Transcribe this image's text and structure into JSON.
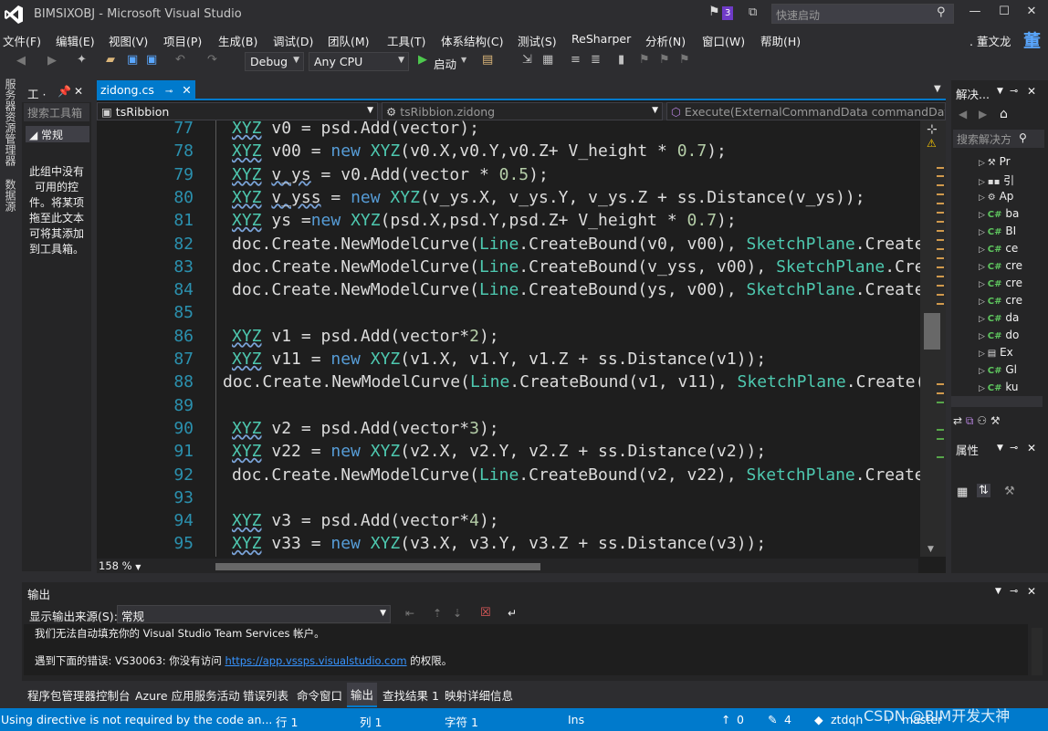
{
  "window": {
    "title": "BIMSIXOBJ - Microsoft Visual Studio",
    "notification_count": "3",
    "quick_launch_placeholder": "快速启动"
  },
  "menu": [
    "文件(F)",
    "编辑(E)",
    "视图(V)",
    "项目(P)",
    "生成(B)",
    "调试(D)",
    "团队(M)",
    "工具(T)",
    "体系结构(C)",
    "测试(S)",
    "ReSharper",
    "分析(N)",
    "窗口(W)",
    "帮助(H)"
  ],
  "user": {
    "name": ". 董文龙",
    "avatar": "董"
  },
  "toolbar": {
    "config": "Debug",
    "platform": "Any CPU",
    "start": "启动"
  },
  "left_strip": {
    "server_explorer": "服务器资源管理器",
    "data_sources": "数据源"
  },
  "toolbox": {
    "title": "工 ·",
    "search_placeholder": "搜索工具箱",
    "group": "◢ 常规",
    "empty_msg": "此组中没有可用的控件。将某项拖至此文本可将其添加到工具箱。"
  },
  "editor": {
    "tab": "zidong.cs",
    "nav_class": "tsRibbion",
    "nav_type": "tsRibbion.zidong",
    "nav_member": "Execute(ExternalCommandData commandData",
    "zoom": "158 %",
    "lines": [
      {
        "num": "77",
        "html": "<span class='t sq'>XYZ</span> v0 = psd.Add(vector);"
      },
      {
        "num": "78",
        "html": "<span class='t sq'>XYZ</span> v00 = <span class='k'>new</span> <span class='t'>XYZ</span>(v0.X,v0.Y,v0.Z+ V_height * <span class='n'>0.7</span>);"
      },
      {
        "num": "79",
        "html": "<span class='t sq'>XYZ</span> <span class='sq'>v_ys</span> = v0.Add(vector * <span class='n'>0.5</span>);"
      },
      {
        "num": "80",
        "html": "<span class='t sq'>XYZ</span> <span class='sq'>v_yss</span> = <span class='k'>new</span> <span class='t'>XYZ</span>(v_ys.X, v_ys.Y, v_ys.Z + ss.Distance(v_ys));"
      },
      {
        "num": "81",
        "html": "<span class='t sq'>XYZ</span> ys =<span class='k'>new</span> <span class='t'>XYZ</span>(psd.X,psd.Y,psd.Z+ V_height * <span class='n'>0.7</span>);"
      },
      {
        "num": "82",
        "html": "doc.Create.NewModelCurve(<span class='t'>Line</span>.CreateBound(v0, v00), <span class='t'>SketchPlane</span>.Create(doc"
      },
      {
        "num": "83",
        "html": "doc.Create.NewModelCurve(<span class='t'>Line</span>.CreateBound(v_yss, v00), <span class='t'>SketchPlane</span>.Create"
      },
      {
        "num": "84",
        "html": "doc.Create.NewModelCurve(<span class='t'>Line</span>.CreateBound(ys, v00), <span class='t'>SketchPlane</span>.Create(doc"
      },
      {
        "num": "85",
        "html": ""
      },
      {
        "num": "86",
        "html": "<span class='t sq'>XYZ</span> v1 = psd.Add(vector*<span class='n'>2</span>);"
      },
      {
        "num": "87",
        "html": "<span class='t sq'>XYZ</span> v11 = <span class='k'>new</span> <span class='t'>XYZ</span>(v1.X, v1.Y, v1.Z + ss.Distance(v1));"
      },
      {
        "num": "88",
        "html": "<span style='margin-left:-10px'></span>doc.Create.NewModelCurve(<span class='t'>Line</span>.CreateBound(v1, v11), <span class='t'>SketchPlane</span>.Create(doc,"
      },
      {
        "num": "89",
        "html": ""
      },
      {
        "num": "90",
        "html": "<span class='t sq'>XYZ</span> v2 = psd.Add(vector*<span class='n'>3</span>);"
      },
      {
        "num": "91",
        "html": "<span class='t sq'>XYZ</span> v22 = <span class='k'>new</span> <span class='t'>XYZ</span>(v2.X, v2.Y, v2.Z + ss.Distance(v2));"
      },
      {
        "num": "92",
        "html": "doc.Create.NewModelCurve(<span class='t'>Line</span>.CreateBound(v2, v22), <span class='t'>SketchPlane</span>.Create(doc"
      },
      {
        "num": "93",
        "html": ""
      },
      {
        "num": "94",
        "html": "<span class='t sq'>XYZ</span> v3 = psd.Add(vector*<span class='n'>4</span>);"
      },
      {
        "num": "95",
        "html": "<span class='t sq'>XYZ</span> v33 = <span class='k'>new</span> <span class='t'>XYZ</span>(v3.X, v3.Y, v3.Z + ss.Distance(v3));"
      }
    ]
  },
  "solution": {
    "title": "解决...",
    "search_placeholder": "搜索解决方",
    "items": [
      {
        "icon": "wrench",
        "label": "Pr"
      },
      {
        "icon": "ref",
        "label": "引"
      },
      {
        "icon": "config",
        "label": "Ap"
      },
      {
        "icon": "cs",
        "label": "ba"
      },
      {
        "icon": "cs",
        "label": "BI"
      },
      {
        "icon": "cs",
        "label": "ce"
      },
      {
        "icon": "cs",
        "label": "cre"
      },
      {
        "icon": "cs",
        "label": "cre"
      },
      {
        "icon": "cs",
        "label": "cre"
      },
      {
        "icon": "cs",
        "label": "da"
      },
      {
        "icon": "cs",
        "label": "do"
      },
      {
        "icon": "form",
        "label": "Ex"
      },
      {
        "icon": "cs",
        "label": "Gl"
      },
      {
        "icon": "cs",
        "label": "ku"
      }
    ]
  },
  "properties": {
    "title": "属性"
  },
  "output": {
    "title": "输出",
    "source_label": "显示输出来源(S):",
    "source": "常规",
    "line1": "我们无法自动填充你的 Visual Studio Team Services 帐户。",
    "line2_prefix": "遇到下面的错误: VS30063: 你没有访问 ",
    "line2_link": "https://app.vssps.visualstudio.com",
    "line2_suffix": " 的权限。"
  },
  "bottom_tabs": [
    "程序包管理器控制台",
    "Azure 应用服务活动",
    "错误列表",
    "命令窗口",
    "输出",
    "查找结果 1",
    "映射详细信息"
  ],
  "status": {
    "message": "Using directive is not required by the code an...",
    "row": "行 1",
    "col": "列 1",
    "char": "字符 1",
    "mode": "Ins",
    "up": "0",
    "edits": "4",
    "repo": "ztdqh",
    "branch": "master",
    "watermark": "CSDN @BIM开发大神"
  },
  "colors": {
    "accent": "#007acc",
    "type": "#4ec9b0",
    "keyword": "#569cd6",
    "number": "#b5cea8",
    "line_num": "#2b91af"
  }
}
